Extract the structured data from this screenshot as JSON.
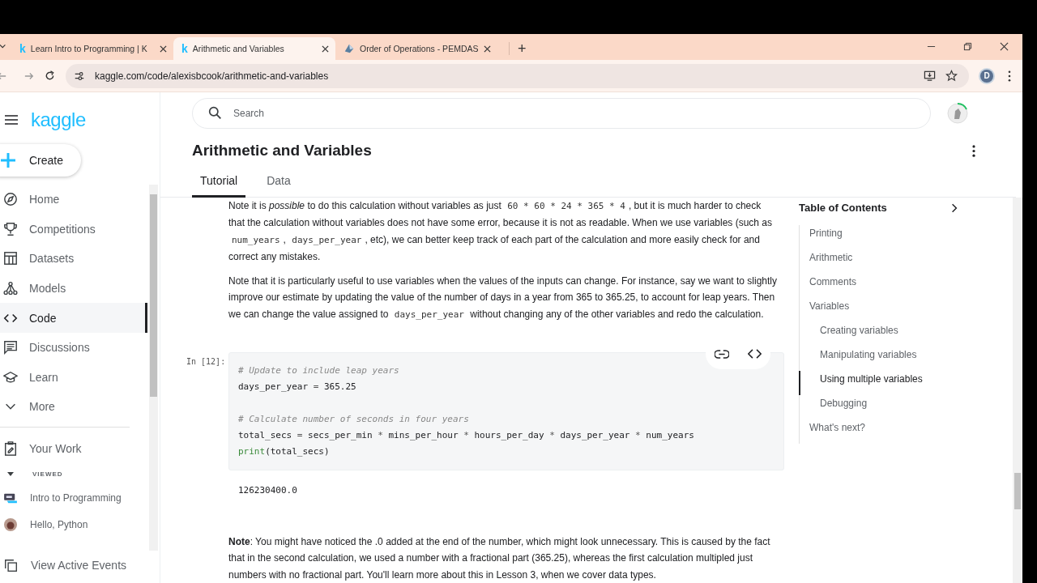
{
  "browser": {
    "tabs": [
      {
        "label": "Learn Intro to Programming | K",
        "favicon": "k",
        "selected": false
      },
      {
        "label": "Arithmetic and Variables",
        "favicon": "k",
        "selected": true
      },
      {
        "label": "Order of Operations - PEMDAS",
        "selected": false
      }
    ],
    "new_tab": "+",
    "url": "kaggle.com/code/alexisbcook/arithmetic-and-variables",
    "profile_initial": "D"
  },
  "sidebar": {
    "logo": "kaggle",
    "create": "Create",
    "nav": [
      {
        "label": "Home",
        "selected": false
      },
      {
        "label": "Competitions",
        "selected": false
      },
      {
        "label": "Datasets",
        "selected": false
      },
      {
        "label": "Models",
        "selected": false
      },
      {
        "label": "Code",
        "selected": true
      },
      {
        "label": "Discussions",
        "selected": false
      },
      {
        "label": "Learn",
        "selected": false
      },
      {
        "label": "More",
        "selected": false
      }
    ],
    "your_work": "Your Work",
    "viewed": {
      "heading": "VIEWED",
      "expanded": true,
      "items": [
        {
          "label": "Intro to Programming"
        },
        {
          "label": "Hello, Python"
        }
      ]
    },
    "footer": "View Active Events"
  },
  "header": {
    "search_placeholder": "Search",
    "title": "Arithmetic and Variables",
    "tabs": [
      {
        "label": "Tutorial",
        "selected": true
      },
      {
        "label": "Data",
        "selected": false
      }
    ]
  },
  "notebook": {
    "paragraphs": [
      [
        {
          "kind": "text",
          "t": "Note it is *possible* to do this calculation without variables as just "
        },
        {
          "kind": "code",
          "t": "60 * 60 * 24 * 365 * 4"
        },
        {
          "kind": "text",
          "t": ", but it is much harder to check that the calculation without variables does not have some error, because it is not as readable. When we use variables (such as "
        },
        {
          "kind": "code",
          "t": "num_years"
        },
        {
          "kind": "text",
          "t": ", "
        },
        {
          "kind": "code",
          "t": "days_per_year"
        },
        {
          "kind": "text",
          "t": ", etc), we can better keep track of each part of the calculation and more easily check for and correct any mistakes."
        }
      ],
      [
        {
          "kind": "text",
          "t": "Note that it is particularly useful to use variables when the values of the inputs can change. For instance, say we want to slightly improve our estimate by updating the value of the number of days in a year from 365 to 365.25, to account for leap years. Then we can change the value assigned to "
        },
        {
          "kind": "code",
          "t": "days_per_year"
        },
        {
          "kind": "text",
          "t": " without changing any of the other variables and redo the calculation."
        }
      ]
    ],
    "cell": {
      "prompt": "In [12]:",
      "blocks": [
        [
          [
            {
              "kind": "comment",
              "t": "# Update to include leap years"
            }
          ],
          [
            {
              "kind": "plain",
              "t": "days_per_year "
            },
            {
              "kind": "op",
              "t": "="
            },
            {
              "kind": "plain",
              "t": " 365.25"
            }
          ]
        ],
        [
          [
            {
              "kind": "comment",
              "t": "# Calculate number of seconds in four years"
            }
          ],
          [
            {
              "kind": "plain",
              "t": "total_secs "
            },
            {
              "kind": "op",
              "t": "="
            },
            {
              "kind": "plain",
              "t": " secs_per_min "
            },
            {
              "kind": "op",
              "t": "*"
            },
            {
              "kind": "plain",
              "t": " mins_per_hour "
            },
            {
              "kind": "op",
              "t": "*"
            },
            {
              "kind": "plain",
              "t": " hours_per_day "
            },
            {
              "kind": "op",
              "t": "*"
            },
            {
              "kind": "plain",
              "t": " days_per_year "
            },
            {
              "kind": "op",
              "t": "*"
            },
            {
              "kind": "plain",
              "t": " num_years"
            }
          ],
          [
            {
              "kind": "builtin",
              "t": "print"
            },
            {
              "kind": "plain",
              "t": "(total_secs)"
            }
          ]
        ]
      ]
    },
    "output": "126230400.0",
    "note": "**Note**: You might have noticed the .0 added at the end of the number, which might look unnecessary. This is caused by the fact that in the second calculation, we used a number with a fractional part (365.25), whereas the first calculation multipled just numbers with no fractional part. You'll learn more about this in Lesson 3, when we cover data types."
  },
  "toc": {
    "title": "Table of Contents",
    "items": [
      {
        "label": "Printing",
        "selected": false
      },
      {
        "label": "Arithmetic",
        "selected": false
      },
      {
        "label": "Comments",
        "selected": false
      },
      {
        "label": "Variables",
        "selected": false,
        "children": [
          {
            "label": "Creating variables",
            "selected": false
          },
          {
            "label": "Manipulating variables",
            "selected": false
          },
          {
            "label": "Using multiple variables",
            "selected": true
          },
          {
            "label": "Debugging",
            "selected": false
          }
        ]
      },
      {
        "label": "What's next?",
        "selected": false
      }
    ]
  }
}
